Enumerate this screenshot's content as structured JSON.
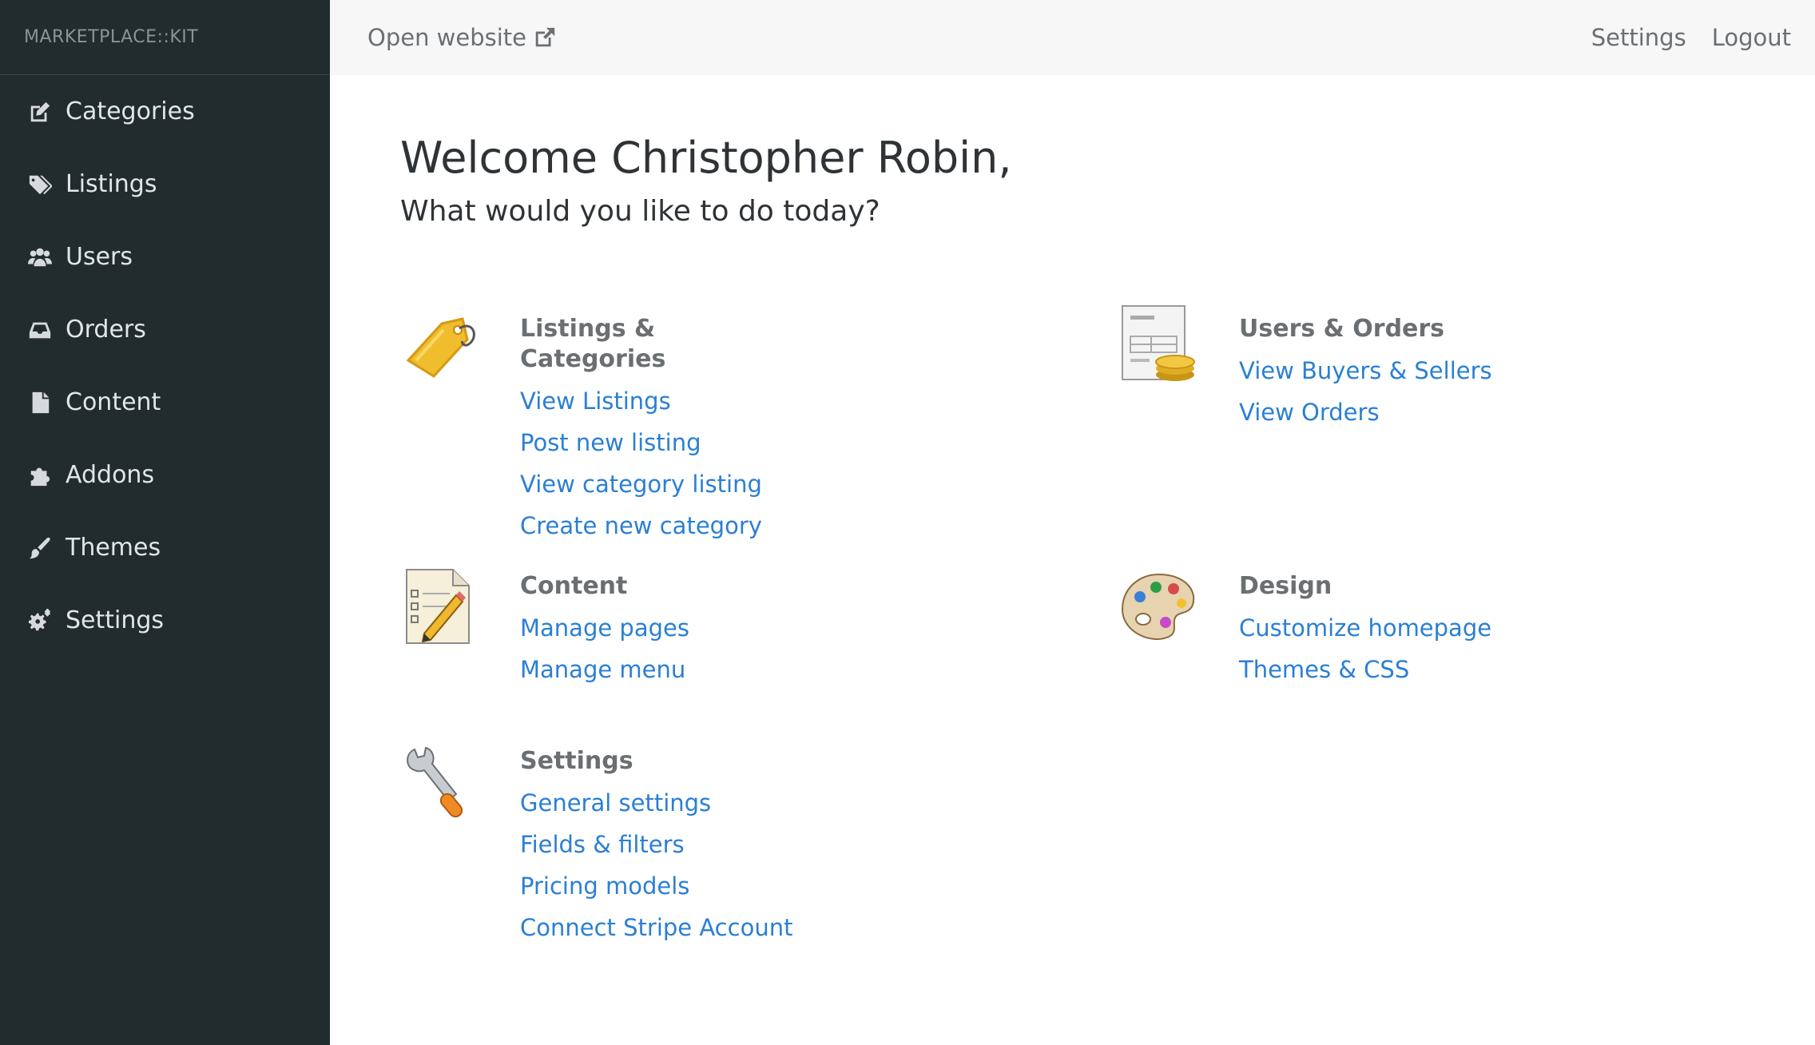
{
  "sidebar": {
    "brand": "MARKETPLACE::KIT",
    "items": [
      {
        "label": "Categories",
        "icon": "edit-icon"
      },
      {
        "label": "Listings",
        "icon": "tags-icon"
      },
      {
        "label": "Users",
        "icon": "users-icon"
      },
      {
        "label": "Orders",
        "icon": "inbox-icon"
      },
      {
        "label": "Content",
        "icon": "file-icon"
      },
      {
        "label": "Addons",
        "icon": "puzzle-icon"
      },
      {
        "label": "Themes",
        "icon": "brush-icon"
      },
      {
        "label": "Settings",
        "icon": "gears-icon"
      }
    ]
  },
  "topbar": {
    "open_website": "Open website",
    "settings": "Settings",
    "logout": "Logout"
  },
  "main": {
    "welcome": "Welcome Christopher Robin,",
    "subtitle": "What would you like to do today?",
    "sections": {
      "listings": {
        "title": "Listings & Categories",
        "icon": "price-tag-icon",
        "links": [
          "View Listings",
          "Post new listing",
          "View category listing",
          "Create new category"
        ]
      },
      "users": {
        "title": "Users & Orders",
        "icon": "invoice-coins-icon",
        "links": [
          "View Buyers & Sellers",
          "View Orders"
        ]
      },
      "content": {
        "title": "Content",
        "icon": "notepad-pencil-icon",
        "links": [
          "Manage pages",
          "Manage menu"
        ]
      },
      "design": {
        "title": "Design",
        "icon": "paint-palette-icon",
        "links": [
          "Customize homepage",
          "Themes & CSS"
        ]
      },
      "settings": {
        "title": "Settings",
        "icon": "wrench-icon",
        "links": [
          "General settings",
          "Fields & filters",
          "Pricing models",
          "Connect Stripe Account"
        ]
      }
    }
  },
  "colors": {
    "sidebar_bg": "#222b2e",
    "link": "#2a7fd4",
    "heading": "#6b6f72"
  }
}
